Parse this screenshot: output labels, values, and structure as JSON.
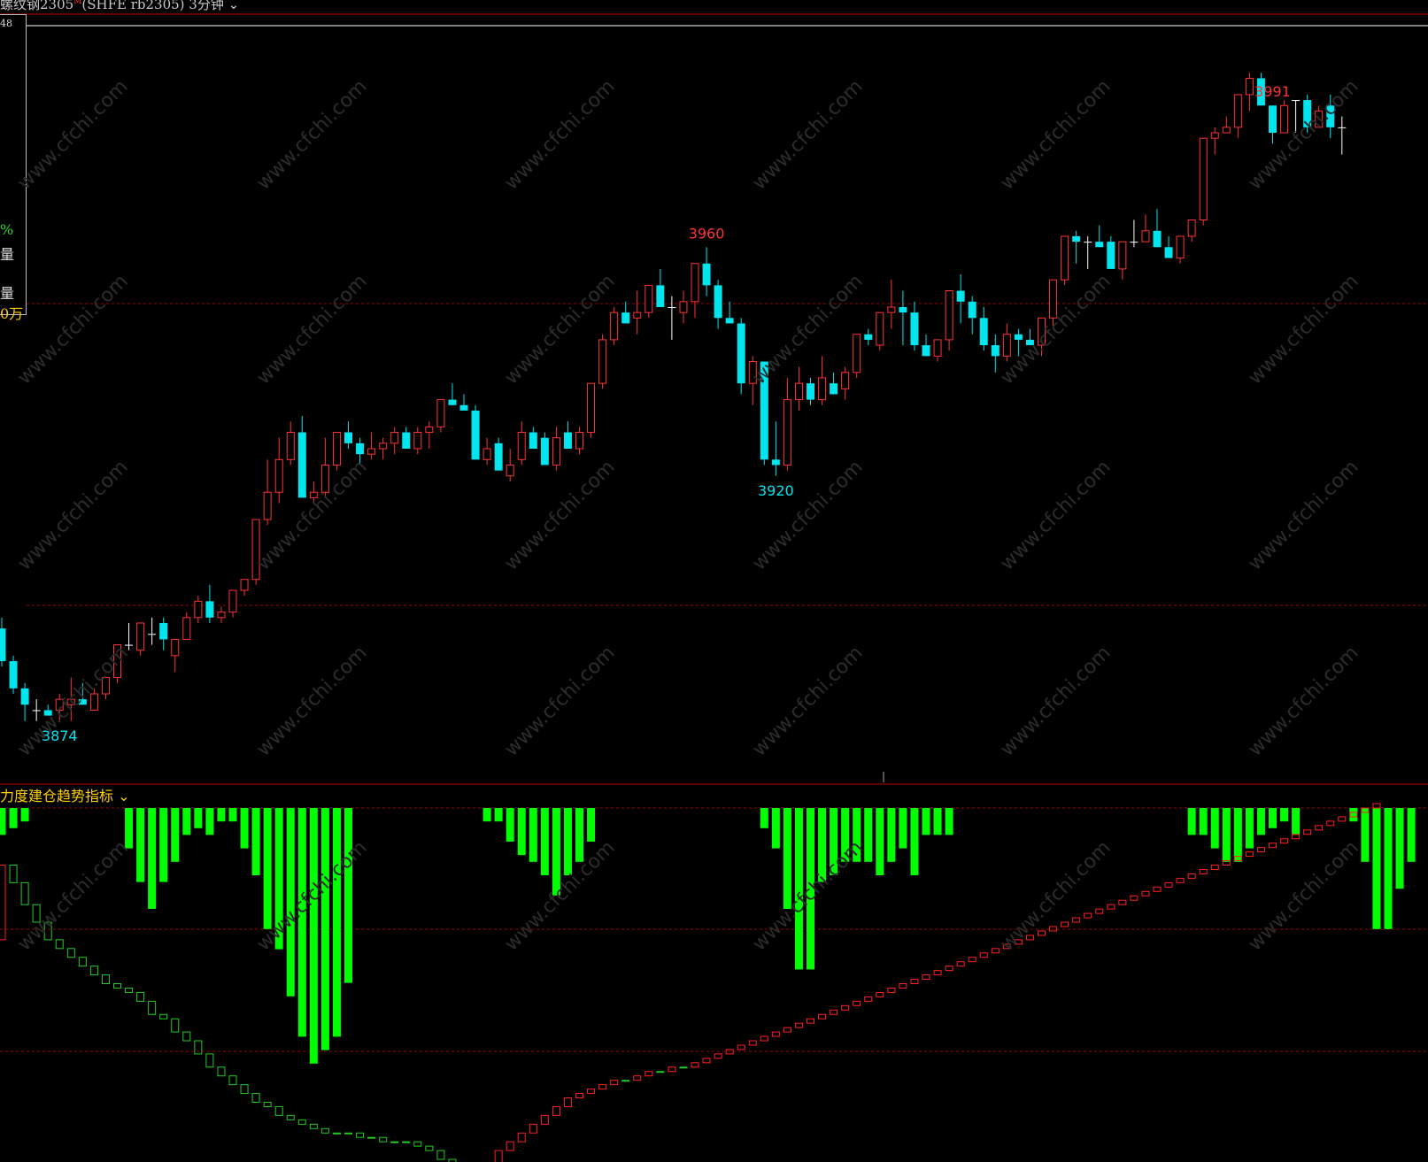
{
  "header": {
    "title_prefix": "螺纹钢2305",
    "title_sup": "M",
    "title_suffix": "(SHFE rb2305)  3分钟",
    "dropdown_icon": "chevron-down-icon"
  },
  "info_panel": {
    "top_value": "48",
    "pct": "%",
    "label_vol1": "量",
    "label_vol2": "量",
    "vol_value": "0万"
  },
  "indicator": {
    "title": "力度建仓趋势指标",
    "dropdown_icon": "chevron-down-icon"
  },
  "watermark": "www.cfchi.com",
  "colors": {
    "up": "#ff3333",
    "down": "#00e5ee",
    "doji": "#ffffff",
    "ind_up": "#ff2020",
    "ind_down": "#22cc22",
    "ind_bar": "#00ff00",
    "grid": "#990000",
    "background": "#000000",
    "title_yellow": "#ffd000"
  },
  "chart_data": [
    {
      "type": "candlestick",
      "title": "螺纹钢2305(SHFE rb2305) 3分钟",
      "interval": "3分钟",
      "ylim": [
        3866,
        3995
      ],
      "price_labels": [
        {
          "text": "3991",
          "index": 110,
          "kind": "high"
        },
        {
          "text": "3960",
          "index": 61,
          "kind": "high"
        },
        {
          "text": "3920",
          "index": 67,
          "kind": "low"
        },
        {
          "text": "3874",
          "index": 5,
          "kind": "low"
        }
      ],
      "candles": [
        [
          3891,
          3893,
          3884,
          3885
        ],
        [
          3885,
          3886,
          3879,
          3880
        ],
        [
          3880,
          3881,
          3874,
          3877
        ],
        [
          3876,
          3878,
          3874,
          3876
        ],
        [
          3876,
          3877,
          3875,
          3875
        ],
        [
          3876,
          3879,
          3874,
          3878
        ],
        [
          3877,
          3882,
          3874,
          3878
        ],
        [
          3878,
          3881,
          3877,
          3877
        ],
        [
          3876,
          3880,
          3876,
          3879
        ],
        [
          3879,
          3882,
          3878,
          3882
        ],
        [
          3882,
          3888,
          3881,
          3888
        ],
        [
          3888,
          3892,
          3887,
          3888
        ],
        [
          3887,
          3891,
          3886,
          3892
        ],
        [
          3890,
          3893,
          3888,
          3890
        ],
        [
          3892,
          3893,
          3887,
          3889
        ],
        [
          3886,
          3888,
          3883,
          3889
        ],
        [
          3889,
          3894,
          3889,
          3893
        ],
        [
          3893,
          3897,
          3892,
          3896
        ],
        [
          3896,
          3899,
          3892,
          3893
        ],
        [
          3893,
          3895,
          3892,
          3894
        ],
        [
          3894,
          3897,
          3893,
          3898
        ],
        [
          3898,
          3900,
          3897,
          3900
        ],
        [
          3900,
          3904,
          3899,
          3911
        ],
        [
          3911,
          3922,
          3910,
          3916
        ],
        [
          3916,
          3926,
          3914,
          3922
        ],
        [
          3922,
          3929,
          3921,
          3927
        ],
        [
          3927,
          3930,
          3917,
          3915
        ],
        [
          3915,
          3918,
          3914,
          3916
        ],
        [
          3916,
          3926,
          3915,
          3921
        ],
        [
          3921,
          3927,
          3920,
          3927
        ],
        [
          3927,
          3929,
          3924,
          3925
        ],
        [
          3925,
          3926,
          3921,
          3923
        ],
        [
          3923,
          3927,
          3922,
          3924
        ],
        [
          3924,
          3926,
          3922,
          3925
        ],
        [
          3925,
          3928,
          3923,
          3927
        ],
        [
          3927,
          3928,
          3924,
          3924
        ],
        [
          3924,
          3928,
          3923,
          3927
        ],
        [
          3927,
          3929,
          3924,
          3928
        ],
        [
          3928,
          3933,
          3927,
          3933
        ],
        [
          3933,
          3936,
          3932,
          3932
        ],
        [
          3932,
          3934,
          3931,
          3931
        ],
        [
          3931,
          3932,
          3922,
          3922
        ],
        [
          3922,
          3926,
          3921,
          3924
        ],
        [
          3925,
          3926,
          3920,
          3920
        ],
        [
          3919,
          3924,
          3918,
          3921
        ],
        [
          3922,
          3929,
          3921,
          3927
        ],
        [
          3927,
          3928,
          3924,
          3924
        ],
        [
          3926,
          3927,
          3921,
          3921
        ],
        [
          3921,
          3928,
          3920,
          3926
        ],
        [
          3927,
          3929,
          3925,
          3924
        ],
        [
          3924,
          3928,
          3923,
          3927
        ],
        [
          3927,
          3935,
          3926,
          3936
        ],
        [
          3936,
          3945,
          3935,
          3944
        ],
        [
          3944,
          3950,
          3943,
          3949
        ],
        [
          3949,
          3951,
          3947,
          3947
        ],
        [
          3948,
          3953,
          3945,
          3949
        ],
        [
          3949,
          3954,
          3948,
          3954
        ],
        [
          3954,
          3957,
          3952,
          3950
        ],
        [
          3950,
          3952,
          3944,
          3950
        ],
        [
          3949,
          3953,
          3947,
          3951
        ],
        [
          3951,
          3954,
          3948,
          3958
        ],
        [
          3958,
          3961,
          3952,
          3954
        ],
        [
          3954,
          3955,
          3946,
          3948
        ],
        [
          3948,
          3951,
          3947,
          3947
        ],
        [
          3947,
          3948,
          3934,
          3936
        ],
        [
          3936,
          3941,
          3932,
          3940
        ],
        [
          3940,
          3940,
          3921,
          3922
        ],
        [
          3922,
          3929,
          3919,
          3921
        ],
        [
          3921,
          3937,
          3920,
          3933
        ],
        [
          3933,
          3939,
          3931,
          3936
        ],
        [
          3936,
          3937,
          3932,
          3933
        ],
        [
          3933,
          3941,
          3932,
          3937
        ],
        [
          3936,
          3938,
          3934,
          3934
        ],
        [
          3935,
          3939,
          3933,
          3938
        ],
        [
          3938,
          3945,
          3937,
          3945
        ],
        [
          3945,
          3946,
          3943,
          3944
        ],
        [
          3943,
          3949,
          3942,
          3949
        ],
        [
          3949,
          3955,
          3946,
          3950
        ],
        [
          3950,
          3953,
          3943,
          3949
        ],
        [
          3949,
          3951,
          3942,
          3943
        ],
        [
          3943,
          3945,
          3941,
          3941
        ],
        [
          3941,
          3944,
          3940,
          3944
        ],
        [
          3944,
          3953,
          3942,
          3953
        ],
        [
          3953,
          3956,
          3947,
          3951
        ],
        [
          3951,
          3952,
          3945,
          3948
        ],
        [
          3948,
          3950,
          3942,
          3943
        ],
        [
          3943,
          3945,
          3938,
          3941
        ],
        [
          3941,
          3947,
          3940,
          3945
        ],
        [
          3945,
          3946,
          3941,
          3944
        ],
        [
          3944,
          3946,
          3943,
          3943
        ],
        [
          3943,
          3946,
          3941,
          3948
        ],
        [
          3948,
          3955,
          3946,
          3955
        ],
        [
          3955,
          3963,
          3954,
          3963
        ],
        [
          3963,
          3964,
          3958,
          3962
        ],
        [
          3962,
          3963,
          3957,
          3962
        ],
        [
          3962,
          3965,
          3962,
          3961
        ],
        [
          3962,
          3963,
          3957,
          3957
        ],
        [
          3957,
          3962,
          3955,
          3962
        ],
        [
          3962,
          3966,
          3961,
          3962
        ],
        [
          3962,
          3967,
          3962,
          3964
        ],
        [
          3964,
          3968,
          3963,
          3961
        ],
        [
          3961,
          3963,
          3960,
          3959
        ],
        [
          3959,
          3963,
          3958,
          3963
        ],
        [
          3963,
          3965,
          3962,
          3966
        ],
        [
          3966,
          3981,
          3965,
          3981
        ],
        [
          3981,
          3983,
          3978,
          3982
        ],
        [
          3982,
          3985,
          3982,
          3983
        ],
        [
          3983,
          3988,
          3981,
          3989
        ],
        [
          3989,
          3993,
          3986,
          3992
        ],
        [
          3992,
          3993,
          3987,
          3987
        ],
        [
          3987,
          3987,
          3980,
          3982
        ],
        [
          3982,
          3988,
          3982,
          3987
        ],
        [
          3988,
          3988,
          3982,
          3988
        ],
        [
          3988,
          3989,
          3982,
          3983
        ],
        [
          3983,
          3987,
          3983,
          3986
        ],
        [
          3987,
          3989,
          3981,
          3983
        ],
        [
          3983,
          3985,
          3978,
          3983
        ]
      ]
    },
    {
      "type": "bar+line",
      "title": "力度建仓趋势指标",
      "ylim": [
        -40,
        40
      ],
      "reference_levels": [
        0,
        15,
        30
      ],
      "bars": [
        -4,
        -3,
        -2,
        0,
        0,
        0,
        0,
        0,
        0,
        0,
        0,
        -6,
        -11,
        -15,
        -11,
        -8,
        -4,
        -3,
        -4,
        -2,
        -2,
        -6,
        -10,
        -18,
        -21,
        -28,
        -34,
        -38,
        -36,
        -34,
        -26,
        0,
        0,
        0,
        0,
        0,
        0,
        0,
        0,
        0,
        0,
        0,
        -2,
        -2,
        -5,
        -7,
        -8,
        -10,
        -13,
        -10,
        -8,
        -5,
        0,
        0,
        0,
        0,
        0,
        0,
        0,
        0,
        0,
        0,
        0,
        0,
        0,
        0,
        -3,
        -6,
        -15,
        -24,
        -24,
        -11,
        -10,
        -8,
        -8,
        -8,
        -10,
        -8,
        -6,
        -10,
        -4,
        -4,
        -4,
        0,
        0,
        0,
        0,
        0,
        0,
        0,
        0,
        0,
        0,
        0,
        0,
        0,
        0,
        0,
        0,
        0,
        0,
        0,
        0,
        -4,
        -4,
        -6,
        -8,
        -8,
        -6,
        -4,
        -3,
        -2,
        -4,
        0,
        0,
        0,
        0,
        -2,
        -8,
        -18,
        -18,
        -12,
        -8,
        0,
        0,
        0,
        0,
        0,
        0,
        0,
        0,
        0,
        0,
        0,
        0,
        0,
        0,
        0,
        0,
        0,
        0,
        0,
        0
      ],
      "line": [
        [
          0,
          17
        ],
        [
          17,
          13
        ],
        [
          13,
          8
        ],
        [
          8,
          4
        ],
        [
          4,
          0
        ],
        [
          0,
          -2
        ],
        [
          -2,
          -4
        ],
        [
          -4,
          -6
        ],
        [
          -6,
          -8
        ],
        [
          -8,
          -10
        ],
        [
          -10,
          -11
        ],
        [
          -11,
          -12
        ],
        [
          -12,
          -14
        ],
        [
          -14,
          -17
        ],
        [
          -17,
          -18
        ],
        [
          -18,
          -21
        ],
        [
          -21,
          -23
        ],
        [
          -23,
          -26
        ],
        [
          -26,
          -29
        ],
        [
          -29,
          -31
        ],
        [
          -31,
          -33
        ],
        [
          -33,
          -35
        ],
        [
          -35,
          -37
        ],
        [
          -37,
          -38
        ],
        [
          -38,
          -40
        ],
        [
          -40,
          -41
        ],
        [
          -41,
          -42
        ],
        [
          -42,
          -43
        ],
        [
          -43,
          -44
        ],
        [
          -44,
          -44
        ],
        [
          -44,
          -44
        ],
        [
          -44,
          -45
        ],
        [
          -45,
          -45
        ],
        [
          -45,
          -46
        ],
        [
          -46,
          -46
        ],
        [
          -46,
          -46
        ],
        [
          -46,
          -47
        ],
        [
          -47,
          -48
        ],
        [
          -48,
          -50
        ],
        [
          -50,
          -51
        ],
        [
          -51,
          -52
        ],
        [
          -52,
          -52
        ],
        [
          -52,
          -51
        ],
        [
          -51,
          -48
        ],
        [
          -48,
          -46
        ],
        [
          -46,
          -44
        ],
        [
          -44,
          -42
        ],
        [
          -42,
          -40
        ],
        [
          -40,
          -38
        ],
        [
          -38,
          -36
        ],
        [
          -36,
          -35
        ],
        [
          -35,
          -34
        ],
        [
          -34,
          -33
        ],
        [
          -33,
          -32
        ],
        [
          -32,
          -32
        ],
        [
          -32,
          -31
        ],
        [
          -31,
          -30
        ],
        [
          -30,
          -30
        ],
        [
          -30,
          -29
        ],
        [
          -29,
          -29
        ],
        [
          -29,
          -28
        ],
        [
          -28,
          -27
        ],
        [
          -27,
          -26
        ],
        [
          -26,
          -25
        ],
        [
          -25,
          -24
        ],
        [
          -24,
          -23
        ],
        [
          -23,
          -22
        ],
        [
          -22,
          -21
        ],
        [
          -21,
          -20
        ],
        [
          -20,
          -19
        ],
        [
          -19,
          -18
        ],
        [
          -18,
          -17
        ],
        [
          -17,
          -16
        ],
        [
          -16,
          -15
        ],
        [
          -15,
          -14
        ],
        [
          -14,
          -13
        ],
        [
          -13,
          -12
        ],
        [
          -12,
          -11
        ],
        [
          -11,
          -10
        ],
        [
          -10,
          -9
        ],
        [
          -9,
          -8
        ],
        [
          -8,
          -7
        ],
        [
          -7,
          -6
        ],
        [
          -6,
          -5
        ],
        [
          -5,
          -4
        ],
        [
          -4,
          -3
        ],
        [
          -3,
          -2
        ],
        [
          -2,
          -1
        ],
        [
          -1,
          0
        ],
        [
          0,
          1
        ],
        [
          1,
          2
        ],
        [
          2,
          3
        ],
        [
          3,
          4
        ],
        [
          4,
          5
        ],
        [
          5,
          6
        ],
        [
          6,
          7
        ],
        [
          7,
          8
        ],
        [
          8,
          9
        ],
        [
          9,
          10
        ],
        [
          10,
          11
        ],
        [
          11,
          12
        ],
        [
          12,
          13
        ],
        [
          13,
          14
        ],
        [
          14,
          15
        ],
        [
          15,
          16
        ],
        [
          16,
          17
        ],
        [
          17,
          18
        ],
        [
          18,
          19
        ],
        [
          19,
          20
        ],
        [
          20,
          21
        ],
        [
          21,
          22
        ],
        [
          22,
          23
        ],
        [
          23,
          24
        ],
        [
          24,
          25
        ],
        [
          25,
          26
        ],
        [
          26,
          27
        ],
        [
          27,
          28
        ],
        [
          28,
          29
        ],
        [
          29,
          30
        ],
        [
          30,
          31
        ]
      ]
    }
  ]
}
